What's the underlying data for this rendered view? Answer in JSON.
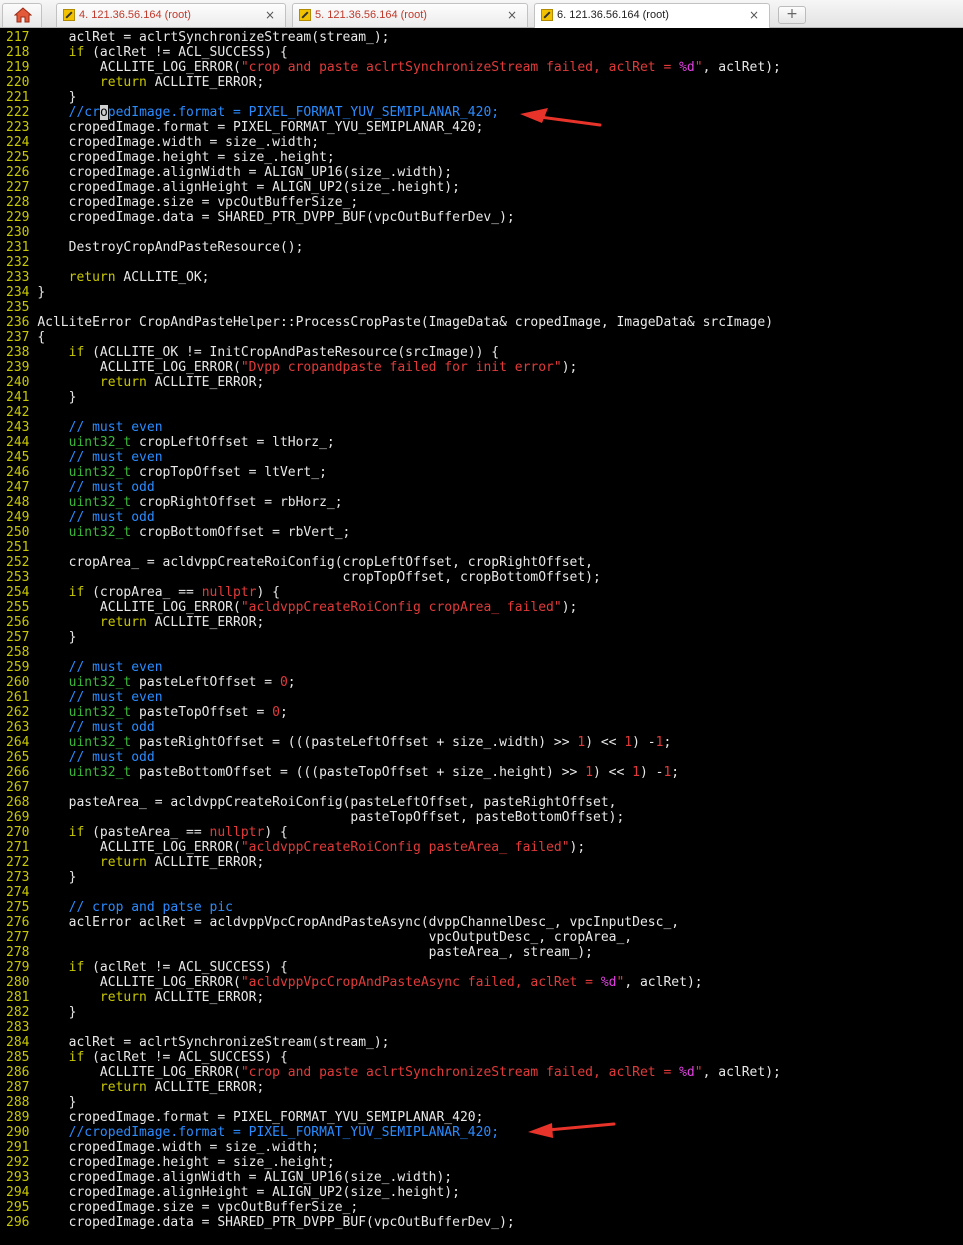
{
  "tabbar": {
    "tabs": [
      {
        "label": "4. 121.36.56.164 (root)",
        "active": false
      },
      {
        "label": "5. 121.36.56.164 (root)",
        "active": false
      },
      {
        "label": "6. 121.36.56.164 (root)",
        "active": true
      }
    ],
    "close_glyph": "×",
    "new_tab_glyph": "+"
  },
  "colors": {
    "background": "#000000",
    "line_number": "#c8c800",
    "plain": "#e8e8e8",
    "keyword": "#c8c800",
    "type": "#3ab73a",
    "string": "#e23a3a",
    "comment": "#2a8cff",
    "format_spec": "#e040e0",
    "annotation_arrow": "#e8332a"
  },
  "code": [
    {
      "n": "217",
      "t": [
        [
          "p",
          "    aclRet = aclrtSynchronizeStream(stream_);"
        ]
      ]
    },
    {
      "n": "218",
      "t": [
        [
          "k",
          "    if"
        ],
        [
          "p",
          " (aclRet != ACL_SUCCESS) {"
        ]
      ]
    },
    {
      "n": "219",
      "t": [
        [
          "p",
          "        ACLLITE_LOG_ERROR("
        ],
        [
          "s",
          "\"crop and paste aclrtSynchronizeStream failed, aclRet = "
        ],
        [
          "f",
          "%d"
        ],
        [
          "s",
          "\""
        ],
        [
          "p",
          ", aclRet);"
        ]
      ]
    },
    {
      "n": "220",
      "t": [
        [
          "k",
          "        return"
        ],
        [
          "p",
          " ACLLITE_ERROR;"
        ]
      ]
    },
    {
      "n": "221",
      "t": [
        [
          "p",
          "    }"
        ]
      ]
    },
    {
      "n": "222",
      "t": [
        [
          "c",
          "    //cr"
        ],
        [
          "cur",
          "o"
        ],
        [
          "c",
          "pedImage.format = PIXEL_FORMAT_YUV_SEMIPLANAR_420;"
        ]
      ]
    },
    {
      "n": "223",
      "t": [
        [
          "p",
          "    cropedImage.format = PIXEL_FORMAT_YVU_SEMIPLANAR_420;"
        ]
      ]
    },
    {
      "n": "224",
      "t": [
        [
          "p",
          "    cropedImage.width = size_.width;"
        ]
      ]
    },
    {
      "n": "225",
      "t": [
        [
          "p",
          "    cropedImage.height = size_.height;"
        ]
      ]
    },
    {
      "n": "226",
      "t": [
        [
          "p",
          "    cropedImage.alignWidth = ALIGN_UP16(size_.width);"
        ]
      ]
    },
    {
      "n": "227",
      "t": [
        [
          "p",
          "    cropedImage.alignHeight = ALIGN_UP2(size_.height);"
        ]
      ]
    },
    {
      "n": "228",
      "t": [
        [
          "p",
          "    cropedImage.size = vpcOutBufferSize_;"
        ]
      ]
    },
    {
      "n": "229",
      "t": [
        [
          "p",
          "    cropedImage.data = SHARED_PTR_DVPP_BUF(vpcOutBufferDev_);"
        ]
      ]
    },
    {
      "n": "230",
      "t": []
    },
    {
      "n": "231",
      "t": [
        [
          "p",
          "    DestroyCropAndPasteResource();"
        ]
      ]
    },
    {
      "n": "232",
      "t": []
    },
    {
      "n": "233",
      "t": [
        [
          "k",
          "    return"
        ],
        [
          "p",
          " ACLLITE_OK;"
        ]
      ]
    },
    {
      "n": "234",
      "t": [
        [
          "p",
          "}"
        ]
      ]
    },
    {
      "n": "235",
      "t": []
    },
    {
      "n": "236",
      "t": [
        [
          "p",
          "AclLiteError CropAndPasteHelper::ProcessCropPaste(ImageData& cropedImage, ImageData& srcImage)"
        ]
      ]
    },
    {
      "n": "237",
      "t": [
        [
          "p",
          "{"
        ]
      ]
    },
    {
      "n": "238",
      "t": [
        [
          "k",
          "    if"
        ],
        [
          "p",
          " (ACLLITE_OK != InitCropAndPasteResource(srcImage)) {"
        ]
      ]
    },
    {
      "n": "239",
      "t": [
        [
          "p",
          "        ACLLITE_LOG_ERROR("
        ],
        [
          "s",
          "\"Dvpp cropandpaste failed for init error\""
        ],
        [
          "p",
          ");"
        ]
      ]
    },
    {
      "n": "240",
      "t": [
        [
          "k",
          "        return"
        ],
        [
          "p",
          " ACLLITE_ERROR;"
        ]
      ]
    },
    {
      "n": "241",
      "t": [
        [
          "p",
          "    }"
        ]
      ]
    },
    {
      "n": "242",
      "t": []
    },
    {
      "n": "243",
      "t": [
        [
          "c",
          "    // must even"
        ]
      ]
    },
    {
      "n": "244",
      "t": [
        [
          "y",
          "    uint32_t"
        ],
        [
          "p",
          " cropLeftOffset = ltHorz_;"
        ]
      ]
    },
    {
      "n": "245",
      "t": [
        [
          "c",
          "    // must even"
        ]
      ]
    },
    {
      "n": "246",
      "t": [
        [
          "y",
          "    uint32_t"
        ],
        [
          "p",
          " cropTopOffset = ltVert_;"
        ]
      ]
    },
    {
      "n": "247",
      "t": [
        [
          "c",
          "    // must odd"
        ]
      ]
    },
    {
      "n": "248",
      "t": [
        [
          "y",
          "    uint32_t"
        ],
        [
          "p",
          " cropRightOffset = rbHorz_;"
        ]
      ]
    },
    {
      "n": "249",
      "t": [
        [
          "c",
          "    // must odd"
        ]
      ]
    },
    {
      "n": "250",
      "t": [
        [
          "y",
          "    uint32_t"
        ],
        [
          "p",
          " cropBottomOffset = rbVert_;"
        ]
      ]
    },
    {
      "n": "251",
      "t": []
    },
    {
      "n": "252",
      "t": [
        [
          "p",
          "    cropArea_ = acldvppCreateRoiConfig(cropLeftOffset, cropRightOffset,"
        ]
      ]
    },
    {
      "n": "253",
      "t": [
        [
          "p",
          "                                       cropTopOffset, cropBottomOffset);"
        ]
      ]
    },
    {
      "n": "254",
      "t": [
        [
          "k",
          "    if"
        ],
        [
          "p",
          " (cropArea_ == "
        ],
        [
          "s",
          "nullptr"
        ],
        [
          "p",
          ") {"
        ]
      ]
    },
    {
      "n": "255",
      "t": [
        [
          "p",
          "        ACLLITE_LOG_ERROR("
        ],
        [
          "s",
          "\"acldvppCreateRoiConfig cropArea_ failed\""
        ],
        [
          "p",
          ");"
        ]
      ]
    },
    {
      "n": "256",
      "t": [
        [
          "k",
          "        return"
        ],
        [
          "p",
          " ACLLITE_ERROR;"
        ]
      ]
    },
    {
      "n": "257",
      "t": [
        [
          "p",
          "    }"
        ]
      ]
    },
    {
      "n": "258",
      "t": []
    },
    {
      "n": "259",
      "t": [
        [
          "c",
          "    // must even"
        ]
      ]
    },
    {
      "n": "260",
      "t": [
        [
          "y",
          "    uint32_t"
        ],
        [
          "p",
          " pasteLeftOffset = "
        ],
        [
          "s",
          "0"
        ],
        [
          "p",
          ";"
        ]
      ]
    },
    {
      "n": "261",
      "t": [
        [
          "c",
          "    // must even"
        ]
      ]
    },
    {
      "n": "262",
      "t": [
        [
          "y",
          "    uint32_t"
        ],
        [
          "p",
          " pasteTopOffset = "
        ],
        [
          "s",
          "0"
        ],
        [
          "p",
          ";"
        ]
      ]
    },
    {
      "n": "263",
      "t": [
        [
          "c",
          "    // must odd"
        ]
      ]
    },
    {
      "n": "264",
      "t": [
        [
          "y",
          "    uint32_t"
        ],
        [
          "p",
          " pasteRightOffset = (((pasteLeftOffset + size_.width) >> "
        ],
        [
          "s",
          "1"
        ],
        [
          "p",
          ") << "
        ],
        [
          "s",
          "1"
        ],
        [
          "p",
          ") -"
        ],
        [
          "s",
          "1"
        ],
        [
          "p",
          ";"
        ]
      ]
    },
    {
      "n": "265",
      "t": [
        [
          "c",
          "    // must odd"
        ]
      ]
    },
    {
      "n": "266",
      "t": [
        [
          "y",
          "    uint32_t"
        ],
        [
          "p",
          " pasteBottomOffset = (((pasteTopOffset + size_.height) >> "
        ],
        [
          "s",
          "1"
        ],
        [
          "p",
          ") << "
        ],
        [
          "s",
          "1"
        ],
        [
          "p",
          ") -"
        ],
        [
          "s",
          "1"
        ],
        [
          "p",
          ";"
        ]
      ]
    },
    {
      "n": "267",
      "t": []
    },
    {
      "n": "268",
      "t": [
        [
          "p",
          "    pasteArea_ = acldvppCreateRoiConfig(pasteLeftOffset, pasteRightOffset,"
        ]
      ]
    },
    {
      "n": "269",
      "t": [
        [
          "p",
          "                                        pasteTopOffset, pasteBottomOffset);"
        ]
      ]
    },
    {
      "n": "270",
      "t": [
        [
          "k",
          "    if"
        ],
        [
          "p",
          " (pasteArea_ == "
        ],
        [
          "s",
          "nullptr"
        ],
        [
          "p",
          ") {"
        ]
      ]
    },
    {
      "n": "271",
      "t": [
        [
          "p",
          "        ACLLITE_LOG_ERROR("
        ],
        [
          "s",
          "\"acldvppCreateRoiConfig pasteArea_ failed\""
        ],
        [
          "p",
          ");"
        ]
      ]
    },
    {
      "n": "272",
      "t": [
        [
          "k",
          "        return"
        ],
        [
          "p",
          " ACLLITE_ERROR;"
        ]
      ]
    },
    {
      "n": "273",
      "t": [
        [
          "p",
          "    }"
        ]
      ]
    },
    {
      "n": "274",
      "t": []
    },
    {
      "n": "275",
      "t": [
        [
          "c",
          "    // crop and patse pic"
        ]
      ]
    },
    {
      "n": "276",
      "t": [
        [
          "p",
          "    aclError aclRet = acldvppVpcCropAndPasteAsync(dvppChannelDesc_, vpcInputDesc_,"
        ]
      ]
    },
    {
      "n": "277",
      "t": [
        [
          "p",
          "                                                  vpcOutputDesc_, cropArea_,"
        ]
      ]
    },
    {
      "n": "278",
      "t": [
        [
          "p",
          "                                                  pasteArea_, stream_);"
        ]
      ]
    },
    {
      "n": "279",
      "t": [
        [
          "k",
          "    if"
        ],
        [
          "p",
          " (aclRet != ACL_SUCCESS) {"
        ]
      ]
    },
    {
      "n": "280",
      "t": [
        [
          "p",
          "        ACLLITE_LOG_ERROR("
        ],
        [
          "s",
          "\"acldvppVpcCropAndPasteAsync failed, aclRet = "
        ],
        [
          "f",
          "%d"
        ],
        [
          "s",
          "\""
        ],
        [
          "p",
          ", aclRet);"
        ]
      ]
    },
    {
      "n": "281",
      "t": [
        [
          "k",
          "        return"
        ],
        [
          "p",
          " ACLLITE_ERROR;"
        ]
      ]
    },
    {
      "n": "282",
      "t": [
        [
          "p",
          "    }"
        ]
      ]
    },
    {
      "n": "283",
      "t": []
    },
    {
      "n": "284",
      "t": [
        [
          "p",
          "    aclRet = aclrtSynchronizeStream(stream_);"
        ]
      ]
    },
    {
      "n": "285",
      "t": [
        [
          "k",
          "    if"
        ],
        [
          "p",
          " (aclRet != ACL_SUCCESS) {"
        ]
      ]
    },
    {
      "n": "286",
      "t": [
        [
          "p",
          "        ACLLITE_LOG_ERROR("
        ],
        [
          "s",
          "\"crop and paste aclrtSynchronizeStream failed, aclRet = "
        ],
        [
          "f",
          "%d"
        ],
        [
          "s",
          "\""
        ],
        [
          "p",
          ", aclRet);"
        ]
      ]
    },
    {
      "n": "287",
      "t": [
        [
          "k",
          "        return"
        ],
        [
          "p",
          " ACLLITE_ERROR;"
        ]
      ]
    },
    {
      "n": "288",
      "t": [
        [
          "p",
          "    }"
        ]
      ]
    },
    {
      "n": "289",
      "t": [
        [
          "p",
          "    cropedImage.format = PIXEL_FORMAT_YVU_SEMIPLANAR_420;"
        ]
      ]
    },
    {
      "n": "290",
      "t": [
        [
          "c",
          "    //cropedImage.format = PIXEL_FORMAT_YUV_SEMIPLANAR_420;"
        ]
      ]
    },
    {
      "n": "291",
      "t": [
        [
          "p",
          "    cropedImage.width = size_.width;"
        ]
      ]
    },
    {
      "n": "292",
      "t": [
        [
          "p",
          "    cropedImage.height = size_.height;"
        ]
      ]
    },
    {
      "n": "293",
      "t": [
        [
          "p",
          "    cropedImage.alignWidth = ALIGN_UP16(size_.width);"
        ]
      ]
    },
    {
      "n": "294",
      "t": [
        [
          "p",
          "    cropedImage.alignHeight = ALIGN_UP2(size_.height);"
        ]
      ]
    },
    {
      "n": "295",
      "t": [
        [
          "p",
          "    cropedImage.size = vpcOutBufferSize_;"
        ]
      ]
    },
    {
      "n": "296",
      "t": [
        [
          "p",
          "    cropedImage.data = SHARED_PTR_DVPP_BUF(vpcOutBufferDev_);"
        ]
      ]
    }
  ]
}
